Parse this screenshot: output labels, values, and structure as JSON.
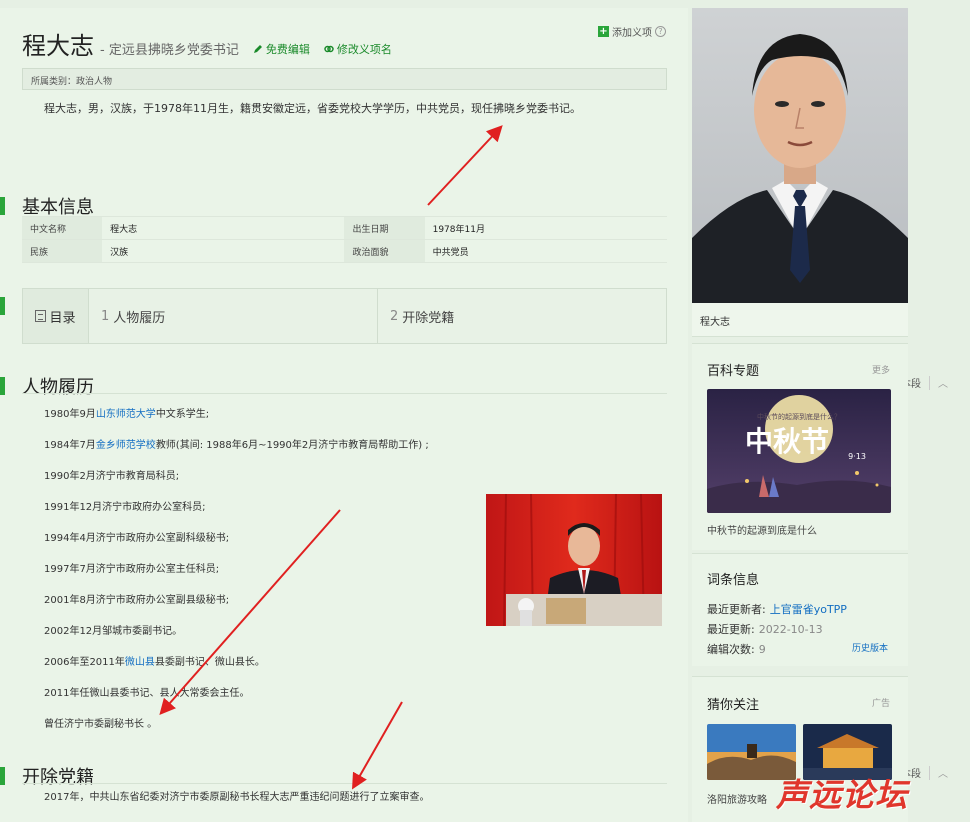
{
  "header": {
    "name": "程大志",
    "subtitle": "- 定远县拂晓乡党委书记",
    "free_edit": "免费编辑",
    "rename": "修改义项名",
    "add_meaning": "添加义项"
  },
  "category": "所属类别：政治人物",
  "summary": "程大志，男，汉族，于1978年11月生，籍贯安徽定远，省委党校大学学历，中共党员，现任拂晓乡党委书记。",
  "basic_info": {
    "title": "基本信息",
    "rows": [
      [
        "中文名称",
        "程大志",
        "出生日期",
        "1978年11月"
      ],
      [
        "民族",
        "汉族",
        "政治面貌",
        "中共党员"
      ]
    ]
  },
  "toc": {
    "label": "目录",
    "items": [
      {
        "num": "1",
        "label": "人物履历"
      },
      {
        "num": "2",
        "label": "开除党籍"
      }
    ]
  },
  "career": {
    "title": "人物履历",
    "edit": "编辑本段",
    "items": [
      {
        "pre": "1980年9月",
        "link": "山东师范大学",
        "post": "中文系学生;"
      },
      {
        "pre": "1984年7月",
        "link": "金乡师范学校",
        "post": "教师(其间: 1988年6月~1990年2月济宁市教育局帮助工作) ;"
      },
      {
        "pre": "1990年2月济宁市教育局科员;",
        "link": "",
        "post": ""
      },
      {
        "pre": "1991年12月济宁市政府办公室科员;",
        "link": "",
        "post": ""
      },
      {
        "pre": "1994年4月济宁市政府办公室副科级秘书;",
        "link": "",
        "post": ""
      },
      {
        "pre": "1997年7月济宁市政府办公室主任科员;",
        "link": "",
        "post": ""
      },
      {
        "pre": "2001年8月济宁市政府办公室副县级秘书;",
        "link": "",
        "post": ""
      },
      {
        "pre": "2002年12月邹城市委副书记。",
        "link": "",
        "post": ""
      },
      {
        "pre": "2006年至2011年",
        "link": "微山县",
        "post": "县委副书记、微山县长。"
      },
      {
        "pre": "2011年任微山县委书记、县人大常委会主任。",
        "link": "",
        "post": ""
      },
      {
        "pre": "曾任济宁市委副秘书长 。",
        "link": "",
        "post": ""
      }
    ]
  },
  "expel": {
    "title": "开除党籍",
    "edit": "编辑本段",
    "text": "2017年，中共山东省纪委对济宁市委原副秘书长程大志严重违纪问题进行了立案审查。"
  },
  "sidebar": {
    "photo_caption": "程大志",
    "topic": {
      "title": "百科专题",
      "more": "更多",
      "image_big": "中秋节",
      "image_small": "中秋节的起源到底是什么？",
      "image_date": "9·13",
      "caption": "中秋节的起源到底是什么"
    },
    "entry_info": {
      "title": "词条信息",
      "updater_label": "最近更新者:",
      "updater": "上官雷雀yoTPP",
      "updated_label": "最近更新:",
      "updated": "2022-10-13",
      "edits_label": "编辑次数:",
      "edits": "9",
      "history": "历史版本"
    },
    "guess": {
      "title": "猜你关注",
      "ad": "广告",
      "caption": "洛阳旅游攻略"
    },
    "watermark": "声远论坛"
  },
  "colors": {
    "accent_green": "#2aa53a",
    "link_blue": "#136ec2",
    "arrow_red": "#e02020"
  }
}
